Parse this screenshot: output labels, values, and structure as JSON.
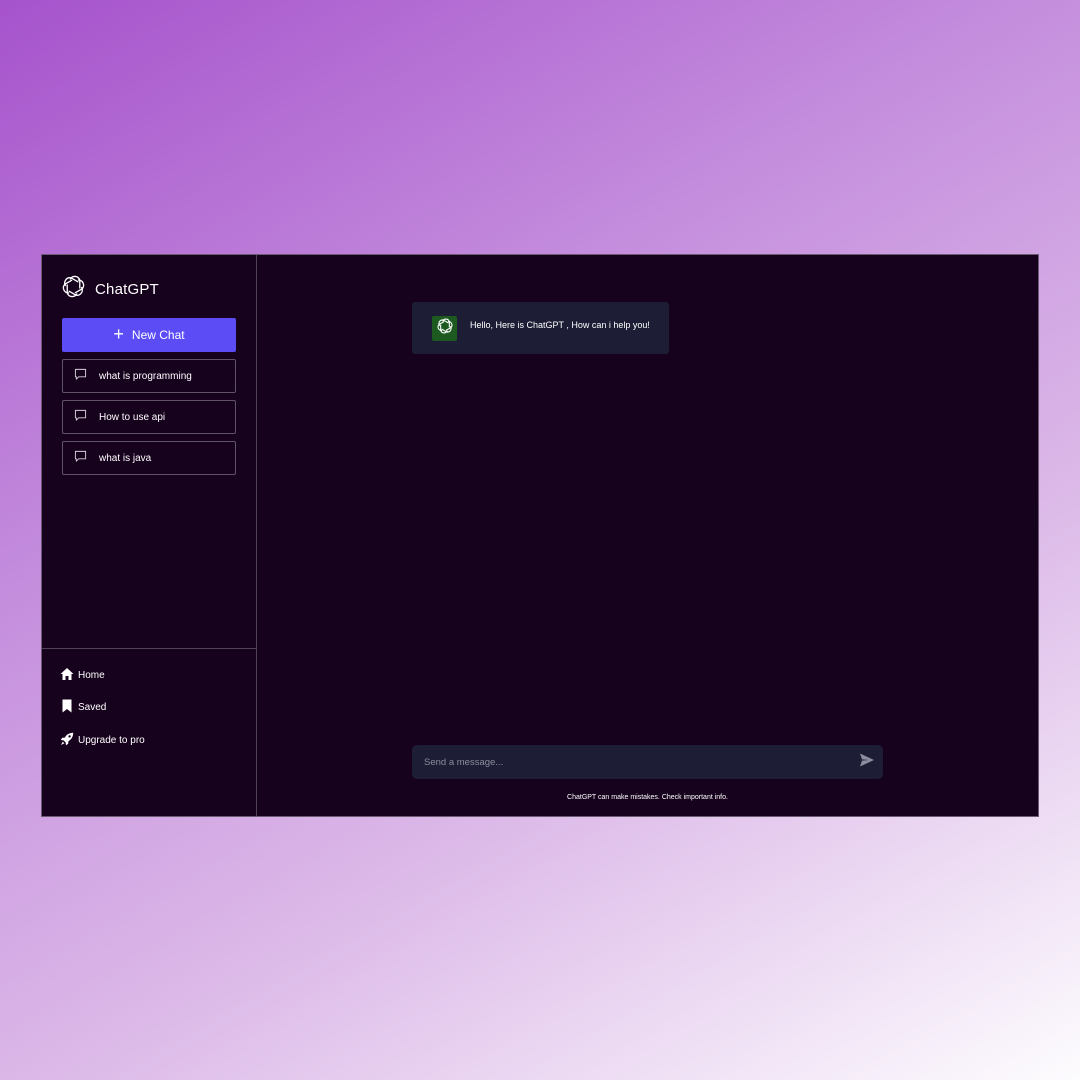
{
  "brand": {
    "name": "ChatGPT",
    "icon": "openai-logo-icon"
  },
  "sidebar": {
    "new_chat_label": "New Chat",
    "history": [
      {
        "label": "what is programming",
        "icon": "chat-bubble-icon"
      },
      {
        "label": "How to use api",
        "icon": "chat-bubble-icon"
      },
      {
        "label": "what is java",
        "icon": "chat-bubble-icon"
      }
    ],
    "nav": [
      {
        "label": "Home",
        "icon": "home-icon"
      },
      {
        "label": "Saved",
        "icon": "bookmark-icon"
      },
      {
        "label": "Upgrade to pro",
        "icon": "rocket-icon"
      }
    ]
  },
  "chat": {
    "messages": [
      {
        "role": "assistant",
        "text": "Hello, Here is ChatGPT , How can i help you!"
      }
    ]
  },
  "composer": {
    "placeholder": "Send a message...",
    "value": "",
    "send_icon": "send-icon"
  },
  "disclaimer": "ChatGPT can make mistakes. Check important info.",
  "colors": {
    "app_background": "#17021e",
    "accent": "#5b4cf5",
    "message_background": "#1d1e36",
    "avatar_background": "#1c5a1f"
  }
}
